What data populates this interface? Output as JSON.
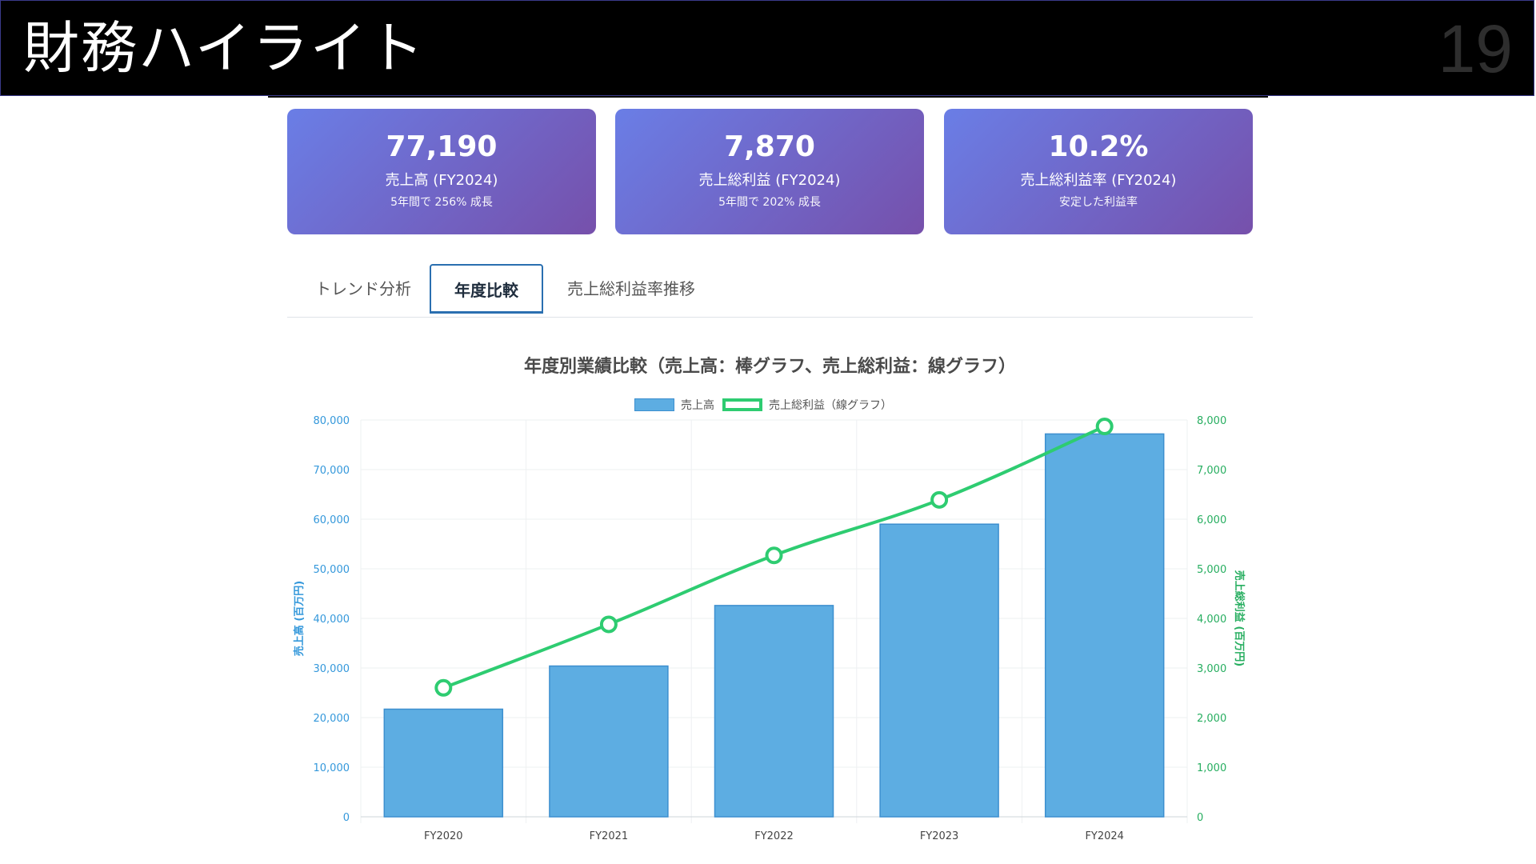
{
  "header": {
    "title": "財務ハイライト",
    "page_number": "19"
  },
  "cards": [
    {
      "value": "77,190",
      "label": "売上高 (FY2024)",
      "note": "5年間で 256% 成長"
    },
    {
      "value": "7,870",
      "label": "売上総利益 (FY2024)",
      "note": "5年間で 202% 成長"
    },
    {
      "value": "10.2%",
      "label": "売上総利益率 (FY2024)",
      "note": "安定した利益率"
    }
  ],
  "tabs": [
    {
      "label": "トレンド分析",
      "active": false
    },
    {
      "label": "年度比較",
      "active": true
    },
    {
      "label": "売上総利益率推移",
      "active": false
    }
  ],
  "colors": {
    "bar": "#5dade2",
    "bar_border": "#3d8fcf",
    "line": "#2ecc71",
    "left_axis": "#3498db",
    "right_axis": "#27ae60"
  },
  "chart_data": {
    "type": "bar",
    "title": "年度別業績比較（売上高：棒グラフ、売上総利益：線グラフ）",
    "categories": [
      "FY2020",
      "FY2021",
      "FY2022",
      "FY2023",
      "FY2024"
    ],
    "series": [
      {
        "name": "売上高",
        "type": "bar",
        "axis": "left",
        "values": [
          21700,
          30400,
          42600,
          59000,
          77190
        ]
      },
      {
        "name": "売上総利益（線グラフ）",
        "type": "line",
        "axis": "right",
        "values": [
          2600,
          3880,
          5270,
          6390,
          7870
        ]
      }
    ],
    "ylabel_left": "売上高 (百万円)",
    "ylabel_right": "売上総利益 (百万円)",
    "ylim_left": [
      0,
      80000
    ],
    "ylim_right": [
      0,
      8000
    ],
    "yticks_left": [
      "0",
      "10,000",
      "20,000",
      "30,000",
      "40,000",
      "50,000",
      "60,000",
      "70,000",
      "80,000"
    ],
    "yticks_right": [
      "0",
      "1,000",
      "2,000",
      "3,000",
      "4,000",
      "5,000",
      "6,000",
      "7,000",
      "8,000"
    ],
    "grid": true,
    "legend": "top-center"
  }
}
